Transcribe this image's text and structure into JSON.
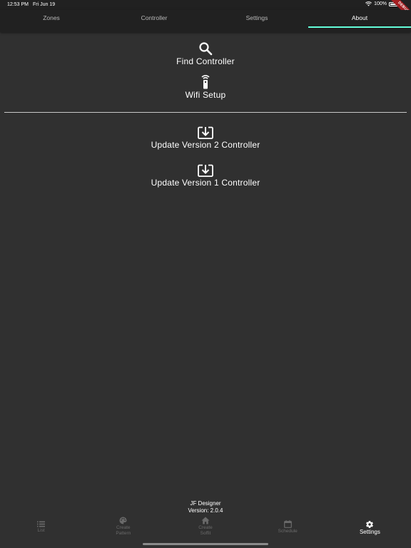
{
  "status_bar": {
    "time": "12:53 PM",
    "date": "Fri Jun 19",
    "battery": "100%",
    "debug_label": "DEBUG"
  },
  "tabs": [
    {
      "label": "Zones",
      "active": false
    },
    {
      "label": "Controller",
      "active": false
    },
    {
      "label": "Settings",
      "active": false
    },
    {
      "label": "About",
      "active": true
    }
  ],
  "actions": {
    "find_controller": {
      "label": "Find Controller",
      "icon": "search-icon"
    },
    "wifi_setup": {
      "label": "Wifi Setup",
      "icon": "remote-icon"
    },
    "update_v2": {
      "label": "Update Version 2 Controller",
      "icon": "download-box-icon"
    },
    "update_v1": {
      "label": "Update Version 1 Controller",
      "icon": "download-box-icon"
    }
  },
  "app_info": {
    "name": "JF Designer",
    "version": "Version: 2.0.4"
  },
  "bottom_nav": [
    {
      "label": "List",
      "icon": "list-icon",
      "active": false
    },
    {
      "label": "Create Pattern",
      "icon": "palette-icon",
      "active": false
    },
    {
      "label": "Create Soffit",
      "icon": "home-icon",
      "active": false
    },
    {
      "label": "Schedule",
      "icon": "calendar-icon",
      "active": false
    },
    {
      "label": "Settings",
      "icon": "gear-icon",
      "active": true
    }
  ],
  "colors": {
    "background": "#303030",
    "app_bar": "#212121",
    "accent": "#64ffda",
    "inactive_nav": "#6a6a6a"
  }
}
